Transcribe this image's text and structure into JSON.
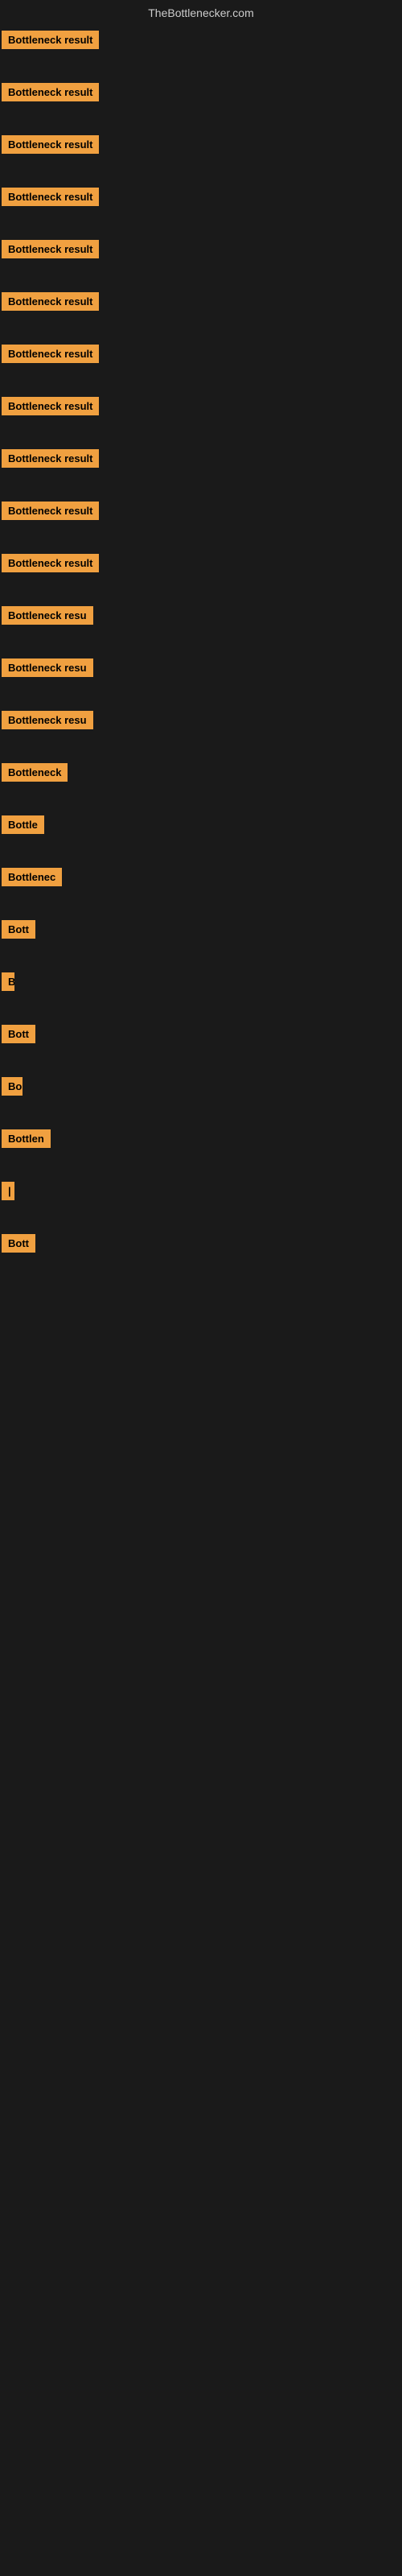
{
  "header": {
    "title": "TheBottlenecker.com"
  },
  "items": [
    {
      "label": "Bottleneck result",
      "width": 155
    },
    {
      "label": "Bottleneck result",
      "width": 155
    },
    {
      "label": "Bottleneck result",
      "width": 155
    },
    {
      "label": "Bottleneck result",
      "width": 155
    },
    {
      "label": "Bottleneck result",
      "width": 155
    },
    {
      "label": "Bottleneck result",
      "width": 155
    },
    {
      "label": "Bottleneck result",
      "width": 155
    },
    {
      "label": "Bottleneck result",
      "width": 155
    },
    {
      "label": "Bottleneck result",
      "width": 155
    },
    {
      "label": "Bottleneck result",
      "width": 155
    },
    {
      "label": "Bottleneck result",
      "width": 155
    },
    {
      "label": "Bottleneck resu",
      "width": 130
    },
    {
      "label": "Bottleneck resu",
      "width": 130
    },
    {
      "label": "Bottleneck resu",
      "width": 130
    },
    {
      "label": "Bottleneck",
      "width": 95
    },
    {
      "label": "Bottle",
      "width": 58
    },
    {
      "label": "Bottlenec",
      "width": 82
    },
    {
      "label": "Bott",
      "width": 44
    },
    {
      "label": "B",
      "width": 14
    },
    {
      "label": "Bott",
      "width": 44
    },
    {
      "label": "Bo",
      "width": 26
    },
    {
      "label": "Bottlen",
      "width": 68
    },
    {
      "label": "|",
      "width": 10
    },
    {
      "label": "Bott",
      "width": 44
    }
  ]
}
